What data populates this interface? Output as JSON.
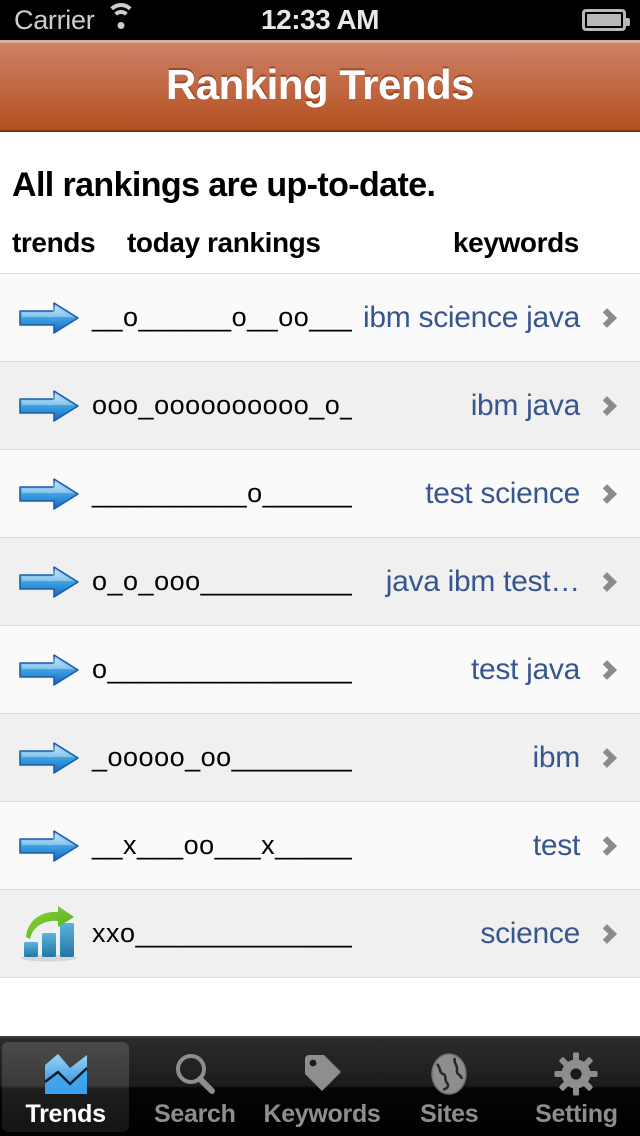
{
  "status_bar": {
    "carrier": "Carrier",
    "wifi_icon": "wifi-icon",
    "time": "12:33 AM",
    "battery_icon": "battery-full-icon"
  },
  "nav_bar": {
    "title": "Ranking Trends"
  },
  "content": {
    "status_message": "All rankings are up-to-date.",
    "columns": {
      "trends": "trends",
      "today_rankings": "today rankings",
      "keywords": "keywords"
    },
    "rows": [
      {
        "trend_icon": "blue-right-arrow-icon",
        "sparkline": "__o______o__oo______",
        "keyword": "ibm science java",
        "chevron": "chevron-right-icon"
      },
      {
        "trend_icon": "blue-right-arrow-icon",
        "sparkline": "ooo_oooooooooo_o____",
        "keyword": "ibm java",
        "chevron": "chevron-right-icon"
      },
      {
        "trend_icon": "blue-right-arrow-icon",
        "sparkline": "__________o___________",
        "keyword": "test science",
        "chevron": "chevron-right-icon"
      },
      {
        "trend_icon": "blue-right-arrow-icon",
        "sparkline": "o_o_ooo_____________",
        "keyword": "java ibm test…",
        "chevron": "chevron-right-icon"
      },
      {
        "trend_icon": "blue-right-arrow-icon",
        "sparkline": "o_________________",
        "keyword": "test java",
        "chevron": "chevron-right-icon"
      },
      {
        "trend_icon": "blue-right-arrow-icon",
        "sparkline": "_ooooo_oo____________",
        "keyword": "ibm",
        "chevron": "chevron-right-icon"
      },
      {
        "trend_icon": "blue-right-arrow-icon",
        "sparkline": "__x___oo___x________",
        "keyword": "test",
        "chevron": "chevron-right-icon"
      },
      {
        "trend_icon": "chart-up-icon",
        "sparkline": "xxo________________",
        "keyword": "science",
        "chevron": "chevron-right-icon"
      }
    ]
  },
  "tab_bar": {
    "tabs": [
      {
        "label": "Trends",
        "icon": "area-chart-icon",
        "active": true
      },
      {
        "label": "Search",
        "icon": "magnifier-icon",
        "active": false
      },
      {
        "label": "Keywords",
        "icon": "tag-icon",
        "active": false
      },
      {
        "label": "Sites",
        "icon": "globe-icon",
        "active": false
      },
      {
        "label": "Setting",
        "icon": "gear-icon",
        "active": false
      }
    ]
  },
  "colors": {
    "nav_bar_top": "#cf8568",
    "nav_bar_bottom": "#b4501f",
    "keyword_link": "#37568f",
    "tab_active_text": "#ffffff",
    "tab_inactive_text": "#8e8e8e",
    "row_odd_bg": "#fafafa",
    "row_even_bg": "#f0f0f0"
  }
}
